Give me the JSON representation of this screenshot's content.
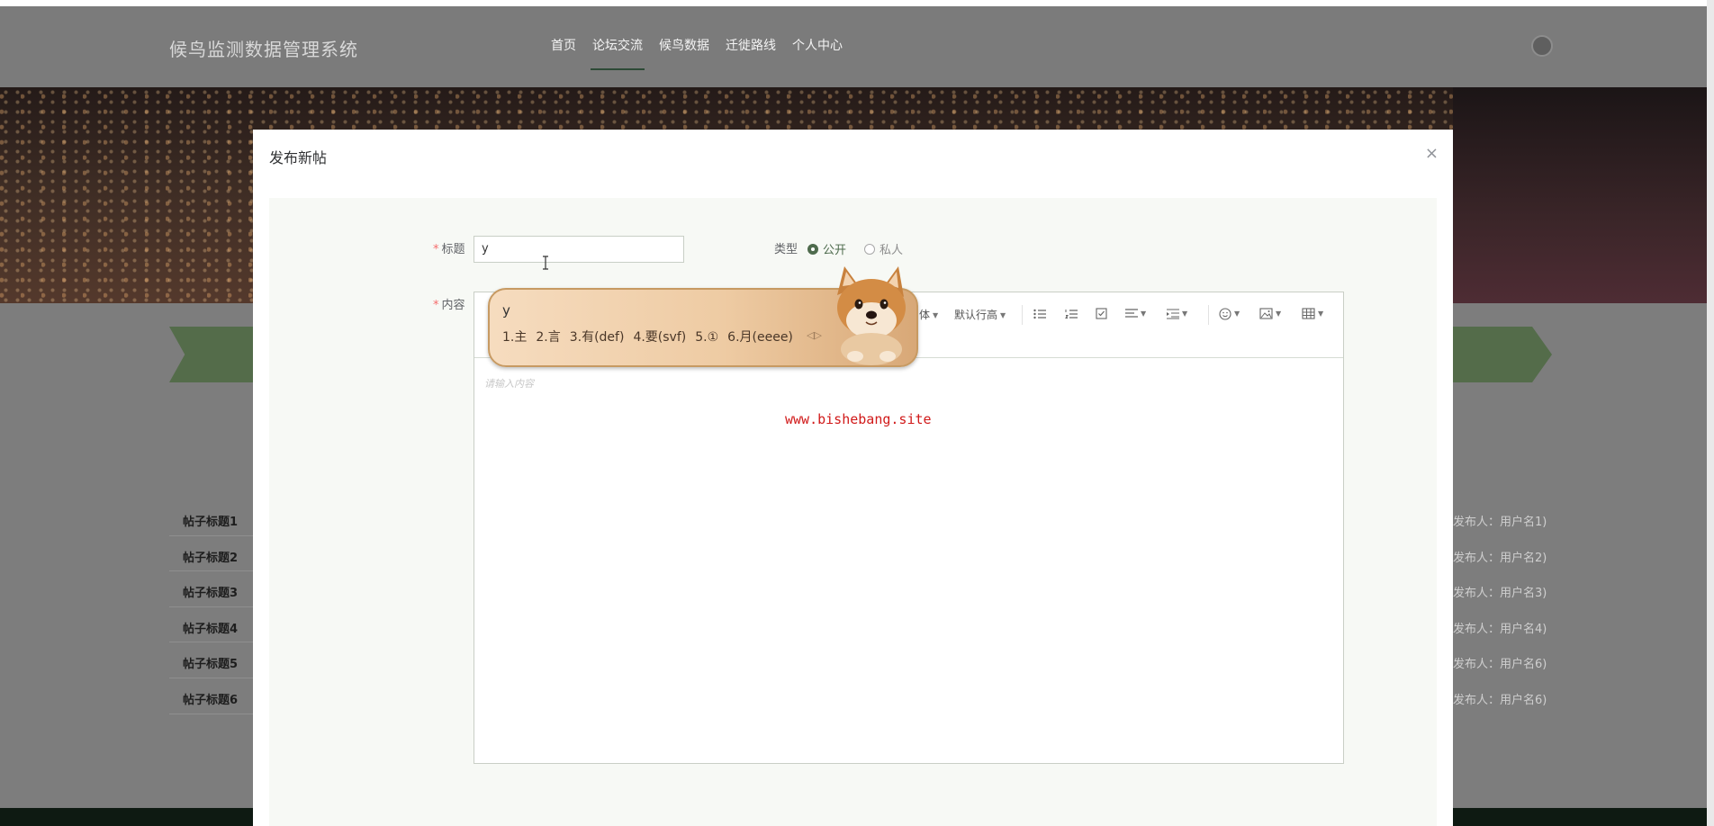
{
  "header": {
    "site_title": "候鸟监测数据管理系统",
    "nav": [
      {
        "label": "首页",
        "active": false
      },
      {
        "label": "论坛交流",
        "active": true
      },
      {
        "label": "候鸟数据",
        "active": false
      },
      {
        "label": "迁徙路线",
        "active": false
      },
      {
        "label": "个人中心",
        "active": false
      }
    ]
  },
  "background_posts": {
    "titles": [
      "帖子标题1",
      "帖子标题2",
      "帖子标题3",
      "帖子标题4",
      "帖子标题5",
      "帖子标题6"
    ],
    "authors": [
      "发布人：用户名1)",
      "发布人：用户名2)",
      "发布人：用户名3)",
      "发布人：用户名4)",
      "发布人：用户名6)",
      "发布人：用户名6)"
    ]
  },
  "modal": {
    "title": "发布新帖",
    "close": "×",
    "form": {
      "title_label": "标题",
      "title_value": "y",
      "type_label": "类型",
      "type_options": [
        {
          "label": "公开",
          "selected": true
        },
        {
          "label": "私人",
          "selected": false
        }
      ],
      "content_label": "内容",
      "content_placeholder": "请输入内容"
    },
    "toolbar": {
      "font_label": "体",
      "line_height_label": "默认行高"
    },
    "watermark": "www.bishebang.site"
  },
  "ime": {
    "composition": "y",
    "candidates": [
      "1.主",
      "2.言",
      "3.有(def)",
      "4.要(svf)",
      "5.①",
      "6.月(eeee)"
    ]
  },
  "colors": {
    "accent": "#4e6b4d",
    "required": "#f56c6c",
    "watermark": "#d11a1a"
  }
}
